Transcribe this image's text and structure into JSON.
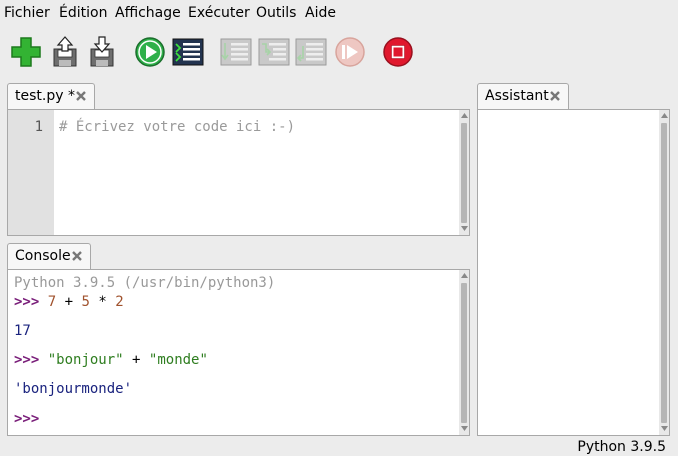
{
  "menu": [
    "Fichier",
    "Édition",
    "Affichage",
    "Exécuter",
    "Outils",
    "Aide"
  ],
  "toolbar": {
    "buttons": [
      "new-file",
      "open-file",
      "save-file",
      "run-script",
      "debug-script",
      "step-over",
      "step-into",
      "step-out",
      "resume",
      "stop"
    ]
  },
  "editor": {
    "tab_label": "test.py *",
    "line_number": "1",
    "code_line": "# Écrivez votre code ici :-)"
  },
  "assistant": {
    "tab_label": "Assistant"
  },
  "console": {
    "tab_label": "Console",
    "banner": "Python 3.9.5 (/usr/bin/python3)",
    "prompt": ">>>",
    "input1": {
      "a": "7",
      "op1": "+",
      "b": "5",
      "op2": "*",
      "c": "2"
    },
    "output1": "17",
    "input2": {
      "s1": "\"bonjour\"",
      "op": "+",
      "s2": "\"monde\""
    },
    "output2": "'bonjourmonde'"
  },
  "status": {
    "interpreter": "Python 3.9.5"
  },
  "colors": {
    "prompt": "#7a1f7a",
    "number": "#a0522d",
    "string": "#2e7d1f",
    "output": "#1a237e",
    "comment": "#9a9a9a",
    "banner": "#999999"
  }
}
